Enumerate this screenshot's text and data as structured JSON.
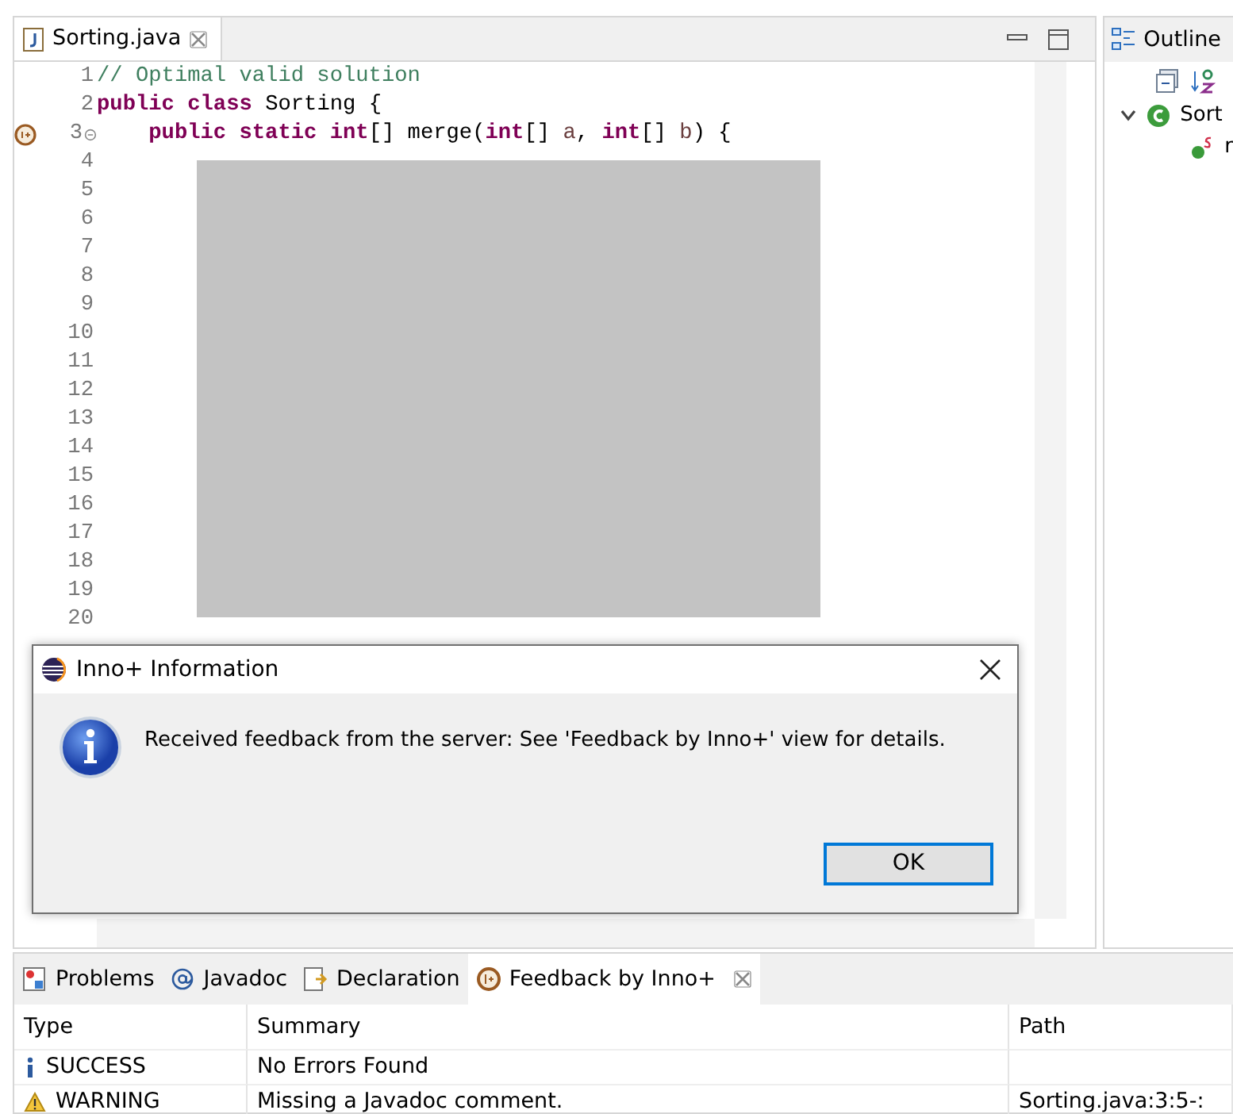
{
  "editor": {
    "tab": {
      "title": "Sorting.java",
      "selected": true,
      "closable": true
    },
    "lines": [
      {
        "number": "1",
        "tokens": [
          {
            "kind": "comment",
            "text": "// Optimal valid solution"
          }
        ]
      },
      {
        "number": "2",
        "tokens": [
          {
            "kind": "keyword",
            "text": "public class"
          },
          {
            "kind": "plain",
            "text": " Sorting {"
          }
        ]
      },
      {
        "number": "3",
        "marker": true,
        "foldable": true,
        "tokens": [
          {
            "kind": "keyword",
            "text": "    public static int"
          },
          {
            "kind": "plain",
            "text": "[] merge("
          },
          {
            "kind": "keyword",
            "text": "int"
          },
          {
            "kind": "plain",
            "text": "[] "
          },
          {
            "kind": "param",
            "text": "a"
          },
          {
            "kind": "plain",
            "text": ", "
          },
          {
            "kind": "keyword",
            "text": "int"
          },
          {
            "kind": "plain",
            "text": "[] "
          },
          {
            "kind": "param",
            "text": "b"
          },
          {
            "kind": "plain",
            "text": ") {"
          }
        ]
      },
      {
        "number": "4"
      },
      {
        "number": "5"
      },
      {
        "number": "6"
      },
      {
        "number": "7"
      },
      {
        "number": "8"
      },
      {
        "number": "9"
      },
      {
        "number": "10"
      },
      {
        "number": "11"
      },
      {
        "number": "12"
      },
      {
        "number": "13"
      },
      {
        "number": "14"
      },
      {
        "number": "15"
      },
      {
        "number": "16"
      },
      {
        "number": "17"
      },
      {
        "number": "18"
      },
      {
        "number": "19"
      },
      {
        "number": "20"
      }
    ]
  },
  "outline": {
    "title": "Outline",
    "tree": [
      {
        "label": "Sort",
        "kind": "class",
        "expanded": true,
        "children": [
          {
            "label": "r",
            "kind": "method"
          }
        ]
      }
    ]
  },
  "dialog": {
    "title": "Inno+ Information",
    "message": "Received feedback from the server: See 'Feedback by Inno+' view for details.",
    "button": "OK"
  },
  "bottom": {
    "tabs": [
      {
        "label": "Problems",
        "kind": "problems",
        "selected": false,
        "closable": false
      },
      {
        "label": "Javadoc",
        "kind": "javadoc",
        "selected": false,
        "closable": false
      },
      {
        "label": "Declaration",
        "kind": "declaration",
        "selected": false,
        "closable": false
      },
      {
        "label": "Feedback by Inno+",
        "kind": "feedback",
        "selected": true,
        "closable": true
      }
    ],
    "columns": [
      "Type",
      "Summary",
      "Path"
    ],
    "rows": [
      {
        "kind": "info",
        "type": "SUCCESS",
        "summary": "No Errors Found"
      },
      {
        "kind": "warning",
        "type": "WARNING",
        "summary": "Missing a Javadoc comment.",
        "path": "Sorting.java:3:5-:"
      }
    ]
  }
}
